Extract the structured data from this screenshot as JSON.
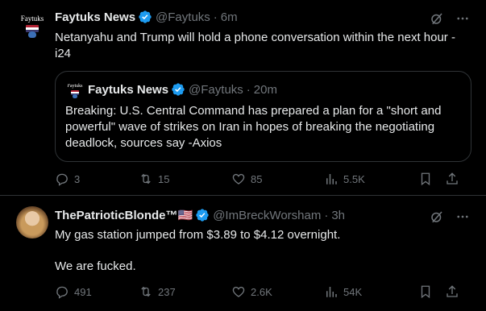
{
  "tweets": [
    {
      "author": "Faytuks News",
      "handle": "@Faytuks",
      "time": "6m",
      "avatar_text": "Faytuks",
      "text_line1": "Netanyahu and Trump will hold a phone conversation within the next hour -",
      "text_line2": "i24",
      "quote": {
        "author": "Faytuks News",
        "handle": "@Faytuks",
        "time": "20m",
        "avatar_text": "Faytuks",
        "text_line1": "Breaking: U.S. Central Command has prepared a plan for a \"short and",
        "text_line2": "powerful\" wave of strikes on Iran in hopes of breaking the negotiating",
        "text_line3": "deadlock, sources say -Axios"
      },
      "stats": {
        "replies": "3",
        "retweets": "15",
        "likes": "85",
        "views": "5.5K"
      }
    },
    {
      "author": "ThePatrioticBlonde™🇺🇸",
      "handle": "@ImBreckWorsham",
      "time": "3h",
      "text_line1": "My gas station jumped from $3.89 to $4.12 overnight.",
      "text_line2": "We are fucked.",
      "stats": {
        "replies": "491",
        "retweets": "237",
        "likes": "2.6K",
        "views": "54K"
      }
    }
  ],
  "sep": "·",
  "colors": {
    "background": "#000000",
    "text": "#e7e9ea",
    "muted": "#71767b",
    "verified": "#1d9bf0",
    "border": "#2f3336"
  },
  "icons": [
    "verified-badge-icon",
    "grok-icon",
    "more-icon",
    "reply-icon",
    "retweet-icon",
    "like-icon",
    "views-icon",
    "bookmark-icon",
    "share-icon"
  ]
}
